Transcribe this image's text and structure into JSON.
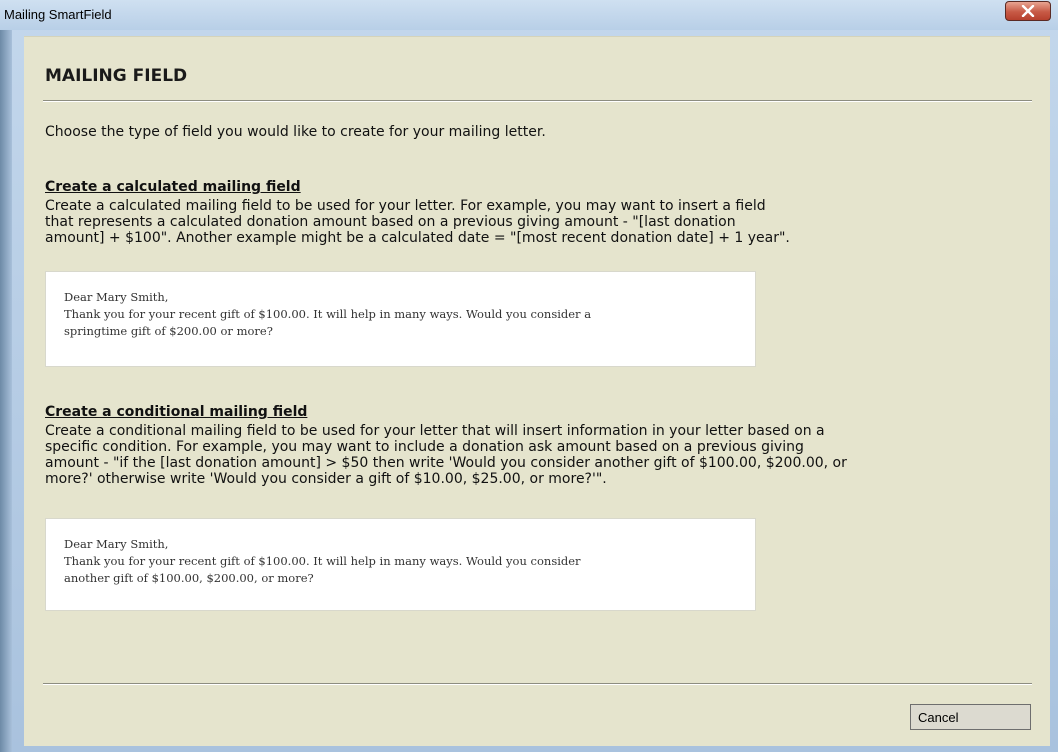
{
  "window": {
    "title": "Mailing SmartField"
  },
  "header": {
    "title": "MAILING FIELD"
  },
  "intro": "Choose the type of field you would like to create for your mailing letter.",
  "sections": [
    {
      "title": "Create a calculated mailing field",
      "description_lines": [
        "Create a calculated mailing field to be used for your letter. For example, you may want to insert a field",
        "that represents a calculated donation amount based on a previous giving amount - \"[last donation",
        "amount] + $100\". Another example might be a calculated date = \"[most recent donation date] + 1 year\"."
      ],
      "example_lines": [
        "Dear Mary Smith,",
        "Thank you for your recent gift of $100.00. It will help in many ways. Would you consider a",
        "springtime gift of $200.00 or more?"
      ]
    },
    {
      "title": "Create a conditional mailing field",
      "description_lines": [
        "Create a conditional mailing field to be used for your letter that will insert information in your letter based on a",
        "specific condition. For example, you may want to include a donation ask amount based on a previous giving",
        "amount - \"if the [last donation amount] > $50 then write 'Would you consider another gift of $100.00, $200.00, or",
        "more?' otherwise write 'Would you consider a gift of $10.00, $25.00, or more?'\"."
      ],
      "example_lines": [
        "Dear Mary Smith,",
        "Thank you for your recent gift of $100.00. It will help in many ways. Would you consider",
        "another gift of $100.00, $200.00, or more?"
      ]
    }
  ],
  "footer": {
    "cancel_label": "Cancel"
  },
  "icons": {
    "close": "close-icon"
  },
  "colors": {
    "panel_background": "#e5e4cd",
    "close_button": "#c75a46",
    "title_bar": "#c3d7ec"
  }
}
